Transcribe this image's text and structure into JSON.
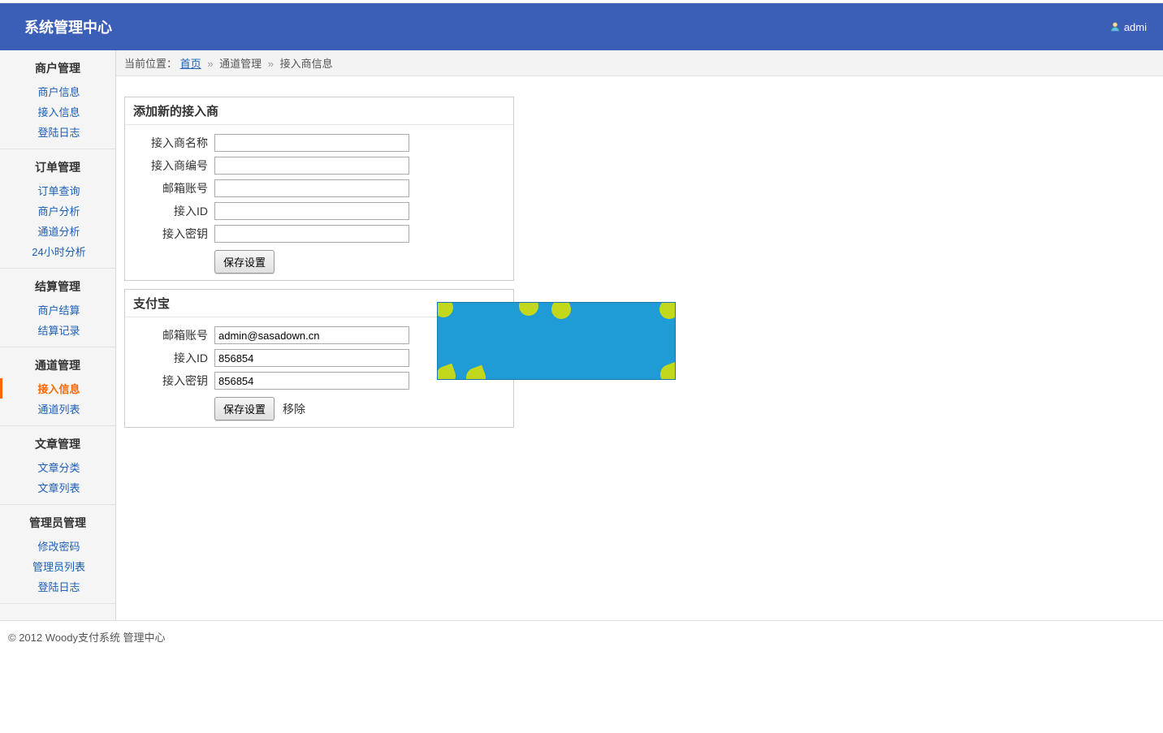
{
  "header": {
    "title": "系统管理中心",
    "username": "admi"
  },
  "breadcrumb": {
    "prefix": "当前位置：",
    "home": "首页",
    "group": "通道管理",
    "page": "接入商信息"
  },
  "sidebar": {
    "groups": [
      {
        "title": "商户管理",
        "items": [
          {
            "label": "商户信息",
            "active": false
          },
          {
            "label": "接入信息",
            "active": false
          },
          {
            "label": "登陆日志",
            "active": false
          }
        ]
      },
      {
        "title": "订单管理",
        "items": [
          {
            "label": "订单查询",
            "active": false
          },
          {
            "label": "商户分析",
            "active": false
          },
          {
            "label": "通道分析",
            "active": false
          },
          {
            "label": "24小时分析",
            "active": false
          }
        ]
      },
      {
        "title": "结算管理",
        "items": [
          {
            "label": "商户结算",
            "active": false
          },
          {
            "label": "结算记录",
            "active": false
          }
        ]
      },
      {
        "title": "通道管理",
        "items": [
          {
            "label": "接入信息",
            "active": true
          },
          {
            "label": "通道列表",
            "active": false
          }
        ]
      },
      {
        "title": "文章管理",
        "items": [
          {
            "label": "文章分类",
            "active": false
          },
          {
            "label": "文章列表",
            "active": false
          }
        ]
      },
      {
        "title": "管理员管理",
        "items": [
          {
            "label": "修改密码",
            "active": false
          },
          {
            "label": "管理员列表",
            "active": false
          },
          {
            "label": "登陆日志",
            "active": false
          }
        ]
      }
    ]
  },
  "panel_new": {
    "title": "添加新的接入商",
    "fields": {
      "name_label": "接入商名称",
      "name_value": "",
      "code_label": "接入商编号",
      "code_value": "",
      "email_label": "邮箱账号",
      "email_value": "",
      "id_label": "接入ID",
      "id_value": "",
      "key_label": "接入密钥",
      "key_value": ""
    },
    "save": "保存设置"
  },
  "panel_alipay": {
    "title": "支付宝",
    "fields": {
      "email_label": "邮箱账号",
      "email_value": "admin@sasadown.cn",
      "id_label": "接入ID",
      "id_value": "856854",
      "key_label": "接入密钥",
      "key_value": "856854"
    },
    "save": "保存设置",
    "remove": "移除"
  },
  "footer": "© 2012 Woody支付系统 管理中心"
}
